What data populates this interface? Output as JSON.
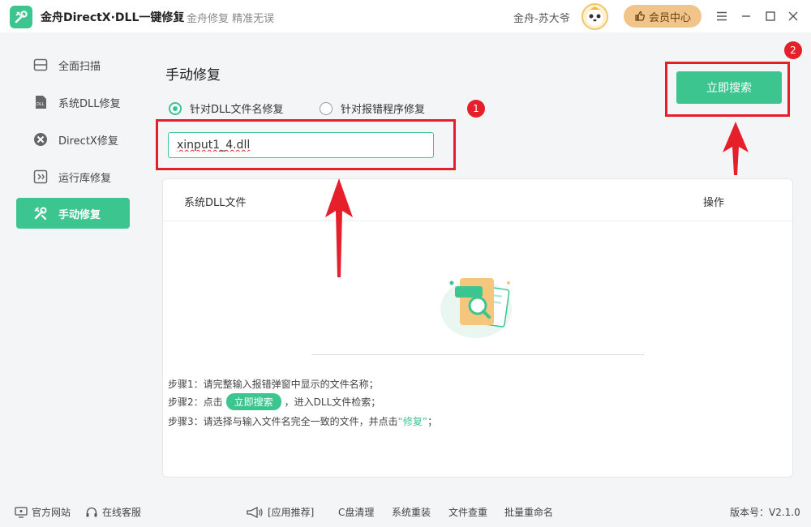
{
  "titlebar": {
    "app_title": "金舟DirectX·DLL一键修复",
    "subtitle": "金舟修复 精准无误",
    "username": "金舟-苏大爷",
    "vip_label": "会员中心"
  },
  "sidebar": {
    "items": [
      {
        "label": "全面扫描",
        "icon": "scan-icon"
      },
      {
        "label": "系统DLL修复",
        "icon": "dll-icon"
      },
      {
        "label": "DirectX修复",
        "icon": "directx-icon"
      },
      {
        "label": "运行库修复",
        "icon": "runtime-icon"
      },
      {
        "label": "手动修复",
        "icon": "tools-icon",
        "active": true
      }
    ]
  },
  "main": {
    "title": "手动修复",
    "radio_options": [
      {
        "label": "针对DLL文件名修复",
        "checked": true
      },
      {
        "label": "针对报错程序修复",
        "checked": false
      }
    ],
    "input_value": "xinput1_4.dll",
    "search_button": "立即搜索",
    "badges": [
      "1",
      "2"
    ],
    "table": {
      "col_file": "系统DLL文件",
      "col_op": "操作"
    },
    "steps": {
      "step1": "步骤1：请完整输入报错弹窗中显示的文件名称；",
      "step2_prefix": "步骤2：点击",
      "step2_pill": "立即搜索",
      "step2_suffix": "，进入DLL文件检索；",
      "step3_prefix": "步骤3：请选择与输入文件名完全一致的文件，并点击",
      "step3_em": "“修复”",
      "step3_suffix": "；"
    }
  },
  "footer": {
    "website": "官方网站",
    "support": "在线客服",
    "recommend": "[应用推荐]",
    "links": [
      "C盘清理",
      "系统重装",
      "文件查重",
      "批量重命名"
    ],
    "version": "版本号：V2.1.0"
  },
  "colors": {
    "accent": "#3cc58f",
    "annotation": "#e6202a",
    "vip": "#f1c58a"
  }
}
